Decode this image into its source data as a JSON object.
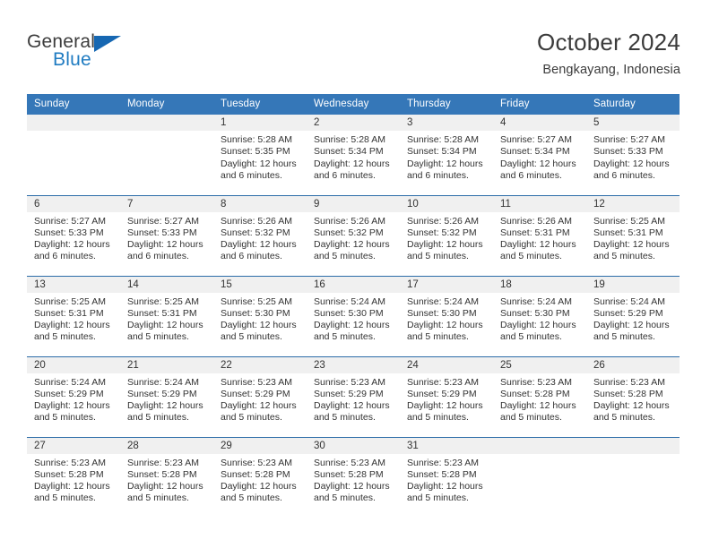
{
  "brand": {
    "name_top": "General",
    "name_bottom": "Blue",
    "logo_icon": "triangle-flag-icon",
    "accent_color": "#1f7bc1"
  },
  "header": {
    "title": "October 2024",
    "location": "Bengkayang, Indonesia"
  },
  "theme": {
    "header_row_bg": "#3577b8",
    "row_divider": "#2c6ca8",
    "daynum_strip_bg": "#f0f0f0",
    "text_color": "#333333"
  },
  "weekday_headers": [
    "Sunday",
    "Monday",
    "Tuesday",
    "Wednesday",
    "Thursday",
    "Friday",
    "Saturday"
  ],
  "weeks": [
    [
      {
        "day": "",
        "sunrise": "",
        "sunset": "",
        "daylight_1": "",
        "daylight_2": ""
      },
      {
        "day": "",
        "sunrise": "",
        "sunset": "",
        "daylight_1": "",
        "daylight_2": ""
      },
      {
        "day": "1",
        "sunrise": "Sunrise: 5:28 AM",
        "sunset": "Sunset: 5:35 PM",
        "daylight_1": "Daylight: 12 hours",
        "daylight_2": "and 6 minutes."
      },
      {
        "day": "2",
        "sunrise": "Sunrise: 5:28 AM",
        "sunset": "Sunset: 5:34 PM",
        "daylight_1": "Daylight: 12 hours",
        "daylight_2": "and 6 minutes."
      },
      {
        "day": "3",
        "sunrise": "Sunrise: 5:28 AM",
        "sunset": "Sunset: 5:34 PM",
        "daylight_1": "Daylight: 12 hours",
        "daylight_2": "and 6 minutes."
      },
      {
        "day": "4",
        "sunrise": "Sunrise: 5:27 AM",
        "sunset": "Sunset: 5:34 PM",
        "daylight_1": "Daylight: 12 hours",
        "daylight_2": "and 6 minutes."
      },
      {
        "day": "5",
        "sunrise": "Sunrise: 5:27 AM",
        "sunset": "Sunset: 5:33 PM",
        "daylight_1": "Daylight: 12 hours",
        "daylight_2": "and 6 minutes."
      }
    ],
    [
      {
        "day": "6",
        "sunrise": "Sunrise: 5:27 AM",
        "sunset": "Sunset: 5:33 PM",
        "daylight_1": "Daylight: 12 hours",
        "daylight_2": "and 6 minutes."
      },
      {
        "day": "7",
        "sunrise": "Sunrise: 5:27 AM",
        "sunset": "Sunset: 5:33 PM",
        "daylight_1": "Daylight: 12 hours",
        "daylight_2": "and 6 minutes."
      },
      {
        "day": "8",
        "sunrise": "Sunrise: 5:26 AM",
        "sunset": "Sunset: 5:32 PM",
        "daylight_1": "Daylight: 12 hours",
        "daylight_2": "and 6 minutes."
      },
      {
        "day": "9",
        "sunrise": "Sunrise: 5:26 AM",
        "sunset": "Sunset: 5:32 PM",
        "daylight_1": "Daylight: 12 hours",
        "daylight_2": "and 5 minutes."
      },
      {
        "day": "10",
        "sunrise": "Sunrise: 5:26 AM",
        "sunset": "Sunset: 5:32 PM",
        "daylight_1": "Daylight: 12 hours",
        "daylight_2": "and 5 minutes."
      },
      {
        "day": "11",
        "sunrise": "Sunrise: 5:26 AM",
        "sunset": "Sunset: 5:31 PM",
        "daylight_1": "Daylight: 12 hours",
        "daylight_2": "and 5 minutes."
      },
      {
        "day": "12",
        "sunrise": "Sunrise: 5:25 AM",
        "sunset": "Sunset: 5:31 PM",
        "daylight_1": "Daylight: 12 hours",
        "daylight_2": "and 5 minutes."
      }
    ],
    [
      {
        "day": "13",
        "sunrise": "Sunrise: 5:25 AM",
        "sunset": "Sunset: 5:31 PM",
        "daylight_1": "Daylight: 12 hours",
        "daylight_2": "and 5 minutes."
      },
      {
        "day": "14",
        "sunrise": "Sunrise: 5:25 AM",
        "sunset": "Sunset: 5:31 PM",
        "daylight_1": "Daylight: 12 hours",
        "daylight_2": "and 5 minutes."
      },
      {
        "day": "15",
        "sunrise": "Sunrise: 5:25 AM",
        "sunset": "Sunset: 5:30 PM",
        "daylight_1": "Daylight: 12 hours",
        "daylight_2": "and 5 minutes."
      },
      {
        "day": "16",
        "sunrise": "Sunrise: 5:24 AM",
        "sunset": "Sunset: 5:30 PM",
        "daylight_1": "Daylight: 12 hours",
        "daylight_2": "and 5 minutes."
      },
      {
        "day": "17",
        "sunrise": "Sunrise: 5:24 AM",
        "sunset": "Sunset: 5:30 PM",
        "daylight_1": "Daylight: 12 hours",
        "daylight_2": "and 5 minutes."
      },
      {
        "day": "18",
        "sunrise": "Sunrise: 5:24 AM",
        "sunset": "Sunset: 5:30 PM",
        "daylight_1": "Daylight: 12 hours",
        "daylight_2": "and 5 minutes."
      },
      {
        "day": "19",
        "sunrise": "Sunrise: 5:24 AM",
        "sunset": "Sunset: 5:29 PM",
        "daylight_1": "Daylight: 12 hours",
        "daylight_2": "and 5 minutes."
      }
    ],
    [
      {
        "day": "20",
        "sunrise": "Sunrise: 5:24 AM",
        "sunset": "Sunset: 5:29 PM",
        "daylight_1": "Daylight: 12 hours",
        "daylight_2": "and 5 minutes."
      },
      {
        "day": "21",
        "sunrise": "Sunrise: 5:24 AM",
        "sunset": "Sunset: 5:29 PM",
        "daylight_1": "Daylight: 12 hours",
        "daylight_2": "and 5 minutes."
      },
      {
        "day": "22",
        "sunrise": "Sunrise: 5:23 AM",
        "sunset": "Sunset: 5:29 PM",
        "daylight_1": "Daylight: 12 hours",
        "daylight_2": "and 5 minutes."
      },
      {
        "day": "23",
        "sunrise": "Sunrise: 5:23 AM",
        "sunset": "Sunset: 5:29 PM",
        "daylight_1": "Daylight: 12 hours",
        "daylight_2": "and 5 minutes."
      },
      {
        "day": "24",
        "sunrise": "Sunrise: 5:23 AM",
        "sunset": "Sunset: 5:29 PM",
        "daylight_1": "Daylight: 12 hours",
        "daylight_2": "and 5 minutes."
      },
      {
        "day": "25",
        "sunrise": "Sunrise: 5:23 AM",
        "sunset": "Sunset: 5:28 PM",
        "daylight_1": "Daylight: 12 hours",
        "daylight_2": "and 5 minutes."
      },
      {
        "day": "26",
        "sunrise": "Sunrise: 5:23 AM",
        "sunset": "Sunset: 5:28 PM",
        "daylight_1": "Daylight: 12 hours",
        "daylight_2": "and 5 minutes."
      }
    ],
    [
      {
        "day": "27",
        "sunrise": "Sunrise: 5:23 AM",
        "sunset": "Sunset: 5:28 PM",
        "daylight_1": "Daylight: 12 hours",
        "daylight_2": "and 5 minutes."
      },
      {
        "day": "28",
        "sunrise": "Sunrise: 5:23 AM",
        "sunset": "Sunset: 5:28 PM",
        "daylight_1": "Daylight: 12 hours",
        "daylight_2": "and 5 minutes."
      },
      {
        "day": "29",
        "sunrise": "Sunrise: 5:23 AM",
        "sunset": "Sunset: 5:28 PM",
        "daylight_1": "Daylight: 12 hours",
        "daylight_2": "and 5 minutes."
      },
      {
        "day": "30",
        "sunrise": "Sunrise: 5:23 AM",
        "sunset": "Sunset: 5:28 PM",
        "daylight_1": "Daylight: 12 hours",
        "daylight_2": "and 5 minutes."
      },
      {
        "day": "31",
        "sunrise": "Sunrise: 5:23 AM",
        "sunset": "Sunset: 5:28 PM",
        "daylight_1": "Daylight: 12 hours",
        "daylight_2": "and 5 minutes."
      },
      {
        "day": "",
        "sunrise": "",
        "sunset": "",
        "daylight_1": "",
        "daylight_2": ""
      },
      {
        "day": "",
        "sunrise": "",
        "sunset": "",
        "daylight_1": "",
        "daylight_2": ""
      }
    ]
  ]
}
